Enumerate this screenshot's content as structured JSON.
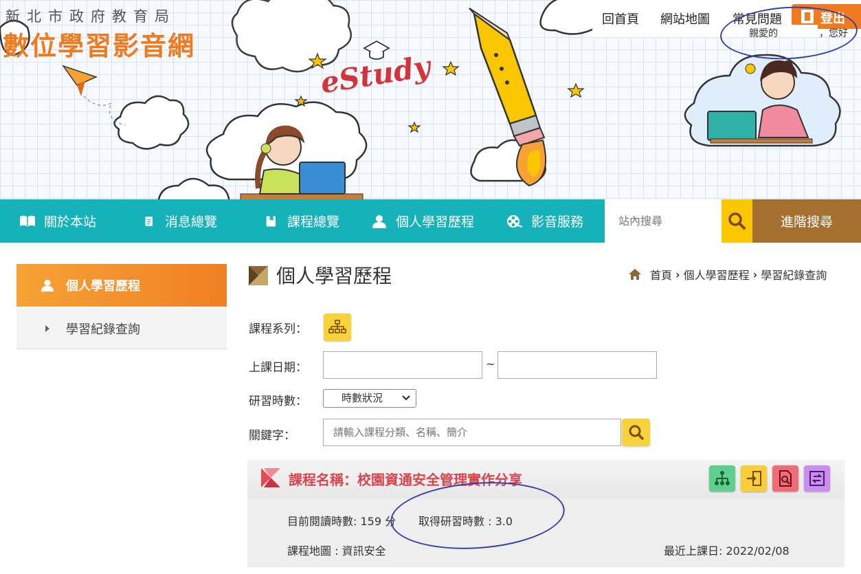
{
  "header": {
    "org_name": "新北市政府教育局",
    "site_name": "數位學習影音網",
    "banner_text": "eStudy",
    "links": {
      "home": "回首頁",
      "sitemap": "網站地圖",
      "faq": "常見問題"
    },
    "logout_label": "登出",
    "greeting_prefix": "親愛的",
    "greeting_suffix": "，您好"
  },
  "nav": {
    "items": [
      {
        "label": "關於本站",
        "icon": "book-icon"
      },
      {
        "label": "消息總覽",
        "icon": "document-icon"
      },
      {
        "label": "課程總覽",
        "icon": "notebook-icon"
      },
      {
        "label": "個人學習歷程",
        "icon": "person-icon"
      },
      {
        "label": "影音服務",
        "icon": "film-reel-icon"
      }
    ],
    "search_placeholder": "站內搜尋",
    "advanced_search": "進階搜尋"
  },
  "sidebar": {
    "heading": "個人學習歷程",
    "items": [
      {
        "label": "學習紀錄查詢"
      }
    ]
  },
  "main": {
    "title": "個人學習歷程",
    "breadcrumb": {
      "home": "首頁",
      "section": "個人學習歷程",
      "current": "學習紀錄查詢"
    },
    "form": {
      "series_label": "課程系列：",
      "date_label": "上課日期：",
      "date_separator": "~",
      "hours_label": "研習時數：",
      "hours_selected": "時數狀況",
      "keyword_label": "關鍵字：",
      "keyword_placeholder": "請輸入課程分類、名稱、簡介"
    },
    "course": {
      "title": "課程名稱：校園資通安全管理實作分享",
      "read_hours": "目前閱讀時數: 159 分",
      "earned_hours": "取得研習時數 : 3.0",
      "course_map": "課程地圖 : 資訊安全",
      "last_date": "最近上課日: 2022/02/08"
    }
  },
  "colors": {
    "accent_orange": "#f07a1f",
    "nav_teal": "#16b2ba",
    "search_yellow": "#f9c600",
    "advanced_brown": "#a5702f",
    "course_red": "#d8454f",
    "annotation_blue": "#3a3fa8"
  }
}
